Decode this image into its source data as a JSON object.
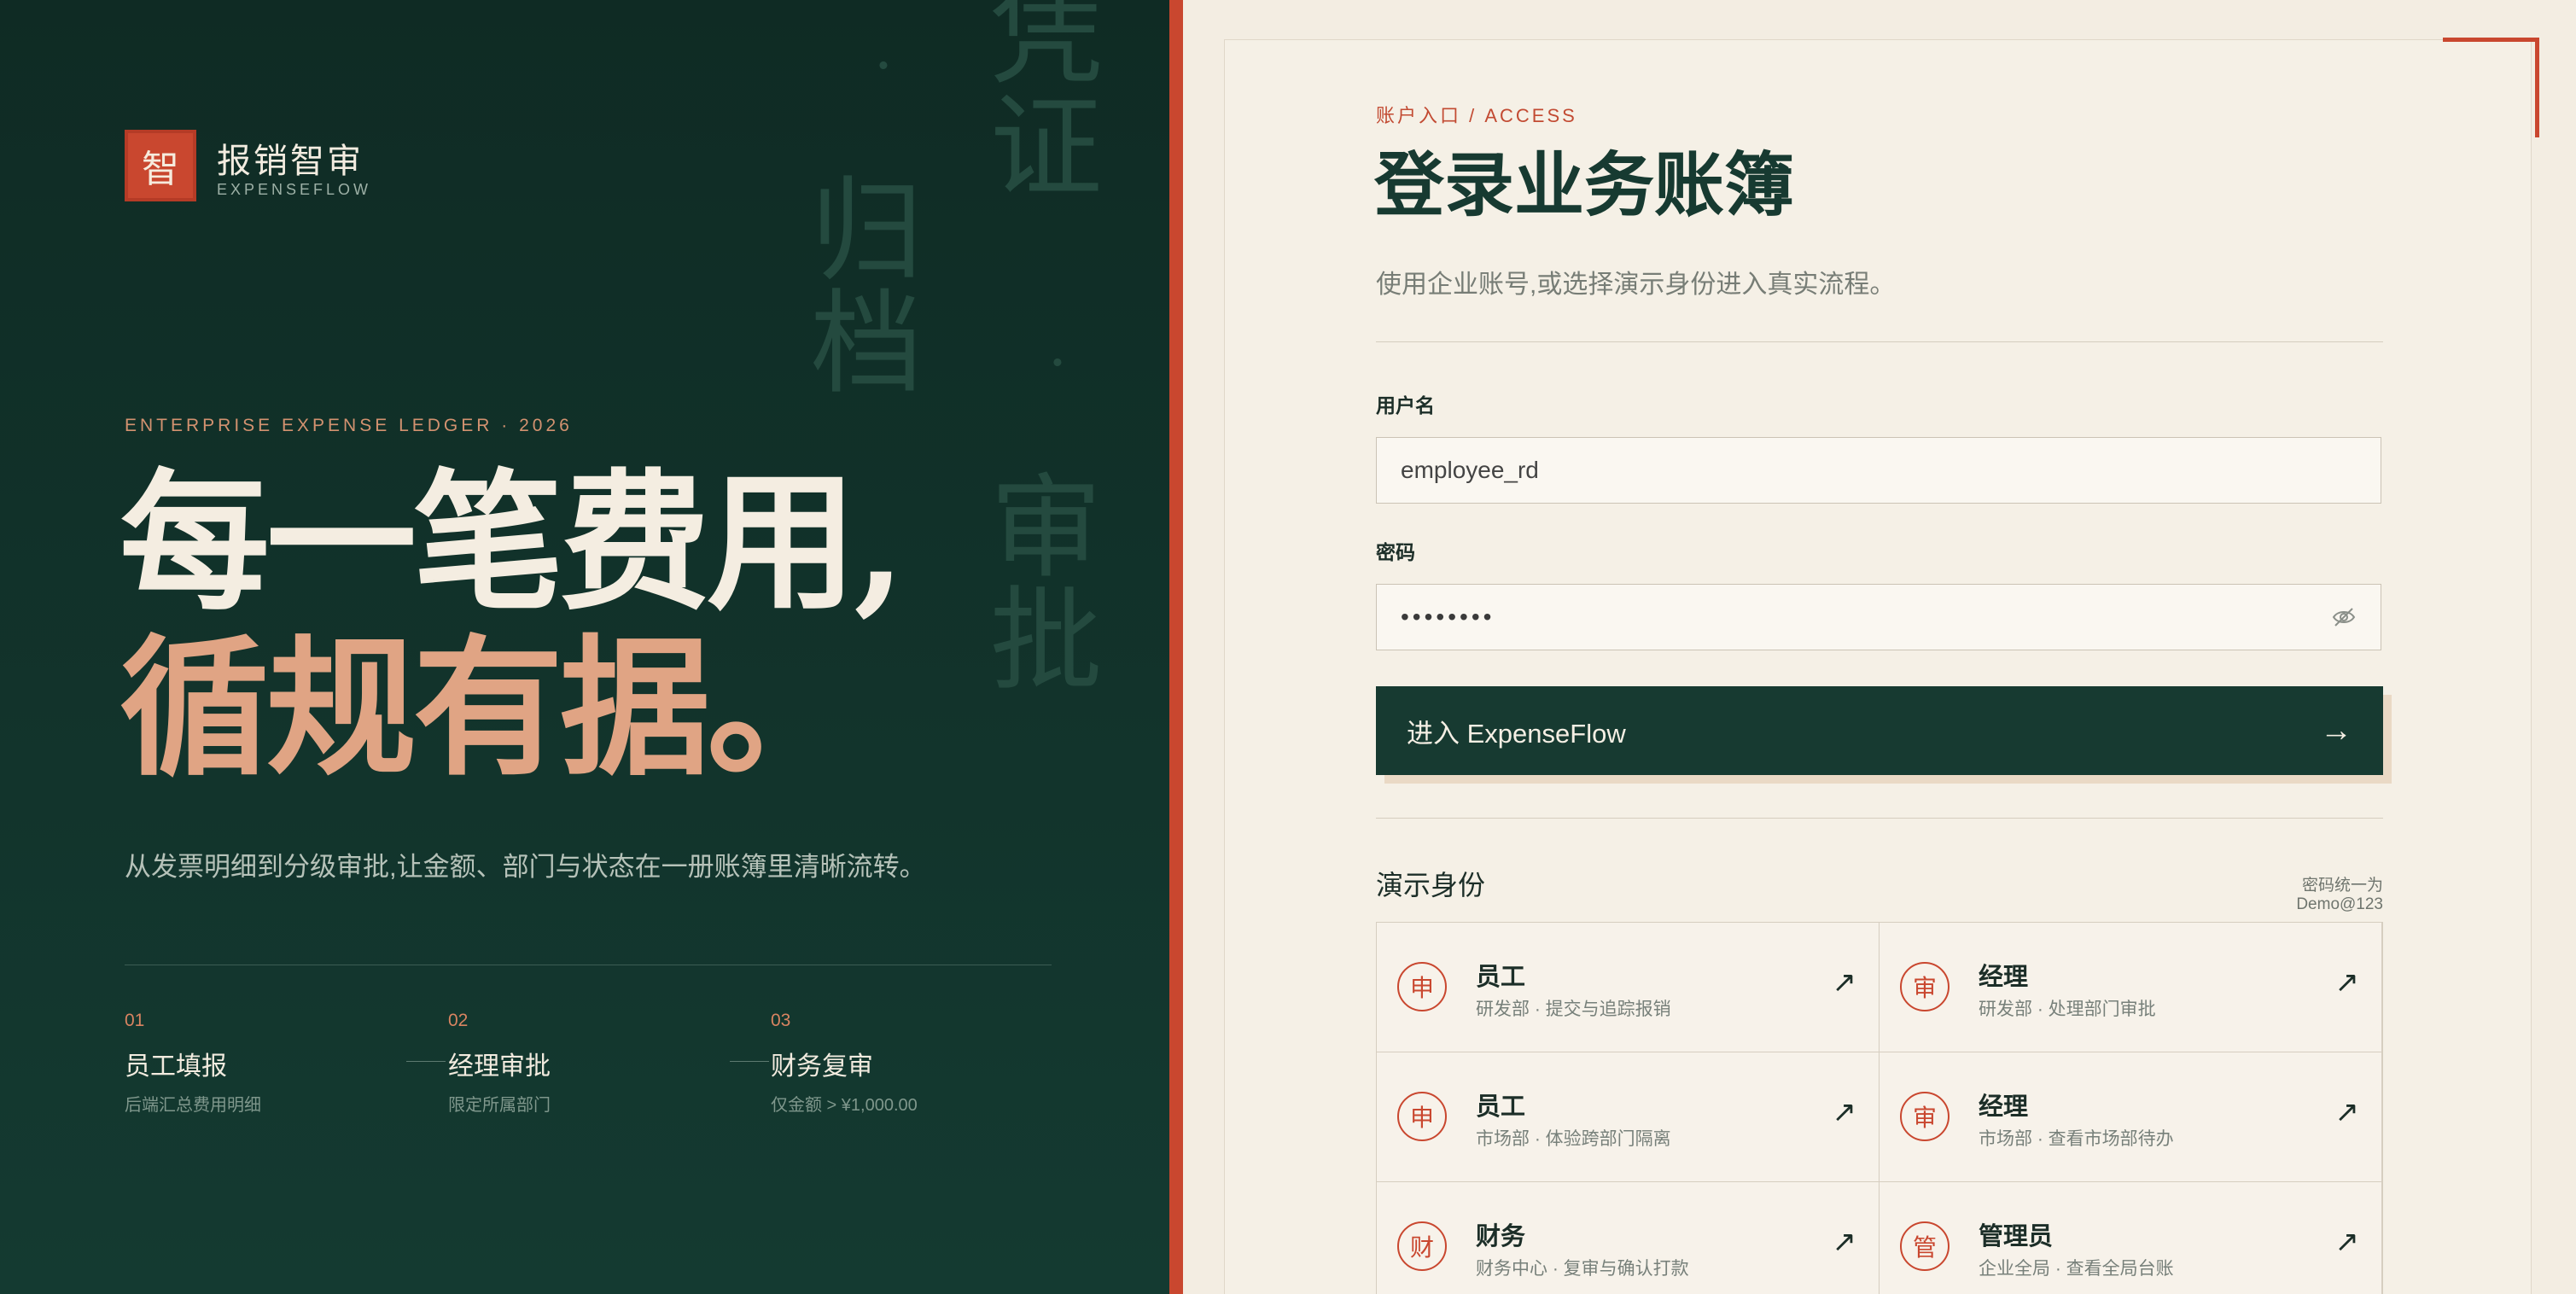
{
  "brand": {
    "logo_char": "智",
    "name": "报销智审",
    "sub": "EXPENSEFLOW"
  },
  "decor": {
    "col1": "凭证",
    "col2": "归档",
    "col3": "审批",
    "dot": "·"
  },
  "hero": {
    "eyebrow": "ENTERPRISE EXPENSE LEDGER · 2026",
    "line1": "每一笔费用,",
    "line2": "循规有据。",
    "lead": "从发票明细到分级审批,让金额、部门与状态在一册账簿里清晰流转。"
  },
  "steps": [
    {
      "num": "01",
      "title": "员工填报",
      "desc": "后端汇总费用明细"
    },
    {
      "num": "02",
      "title": "经理审批",
      "desc": "限定所属部门"
    },
    {
      "num": "03",
      "title": "财务复审",
      "desc": "仅金额 > ¥1,000.00"
    }
  ],
  "login": {
    "eyebrow": "账户入口 / ACCESS",
    "title": "登录业务账簿",
    "subtitle": "使用企业账号,或选择演示身份进入真实流程。",
    "username_label": "用户名",
    "username_value": "employee_rd",
    "password_label": "密码",
    "password_value": "••••••••",
    "submit_label": "进入 ExpenseFlow",
    "submit_arrow": "→"
  },
  "demo": {
    "title": "演示身份",
    "note": "密码统一为 Demo@123",
    "roles": [
      {
        "badge": "申",
        "name": "员工",
        "desc": "研发部 · 提交与追踪报销"
      },
      {
        "badge": "审",
        "name": "经理",
        "desc": "研发部 · 处理部门审批"
      },
      {
        "badge": "申",
        "name": "员工",
        "desc": "市场部 · 体验跨部门隔离"
      },
      {
        "badge": "审",
        "name": "经理",
        "desc": "市场部 · 查看市场部待办"
      },
      {
        "badge": "财",
        "name": "财务",
        "desc": "财务中心 · 复审与确认打款"
      },
      {
        "badge": "管",
        "name": "管理员",
        "desc": "企业全局 · 查看全局台账"
      }
    ],
    "go_arrow": "↗"
  },
  "colors": {
    "panel_green": "#173a31",
    "accent_red": "#c9472f",
    "cream": "#f3ede2",
    "peach": "#e0a484"
  }
}
